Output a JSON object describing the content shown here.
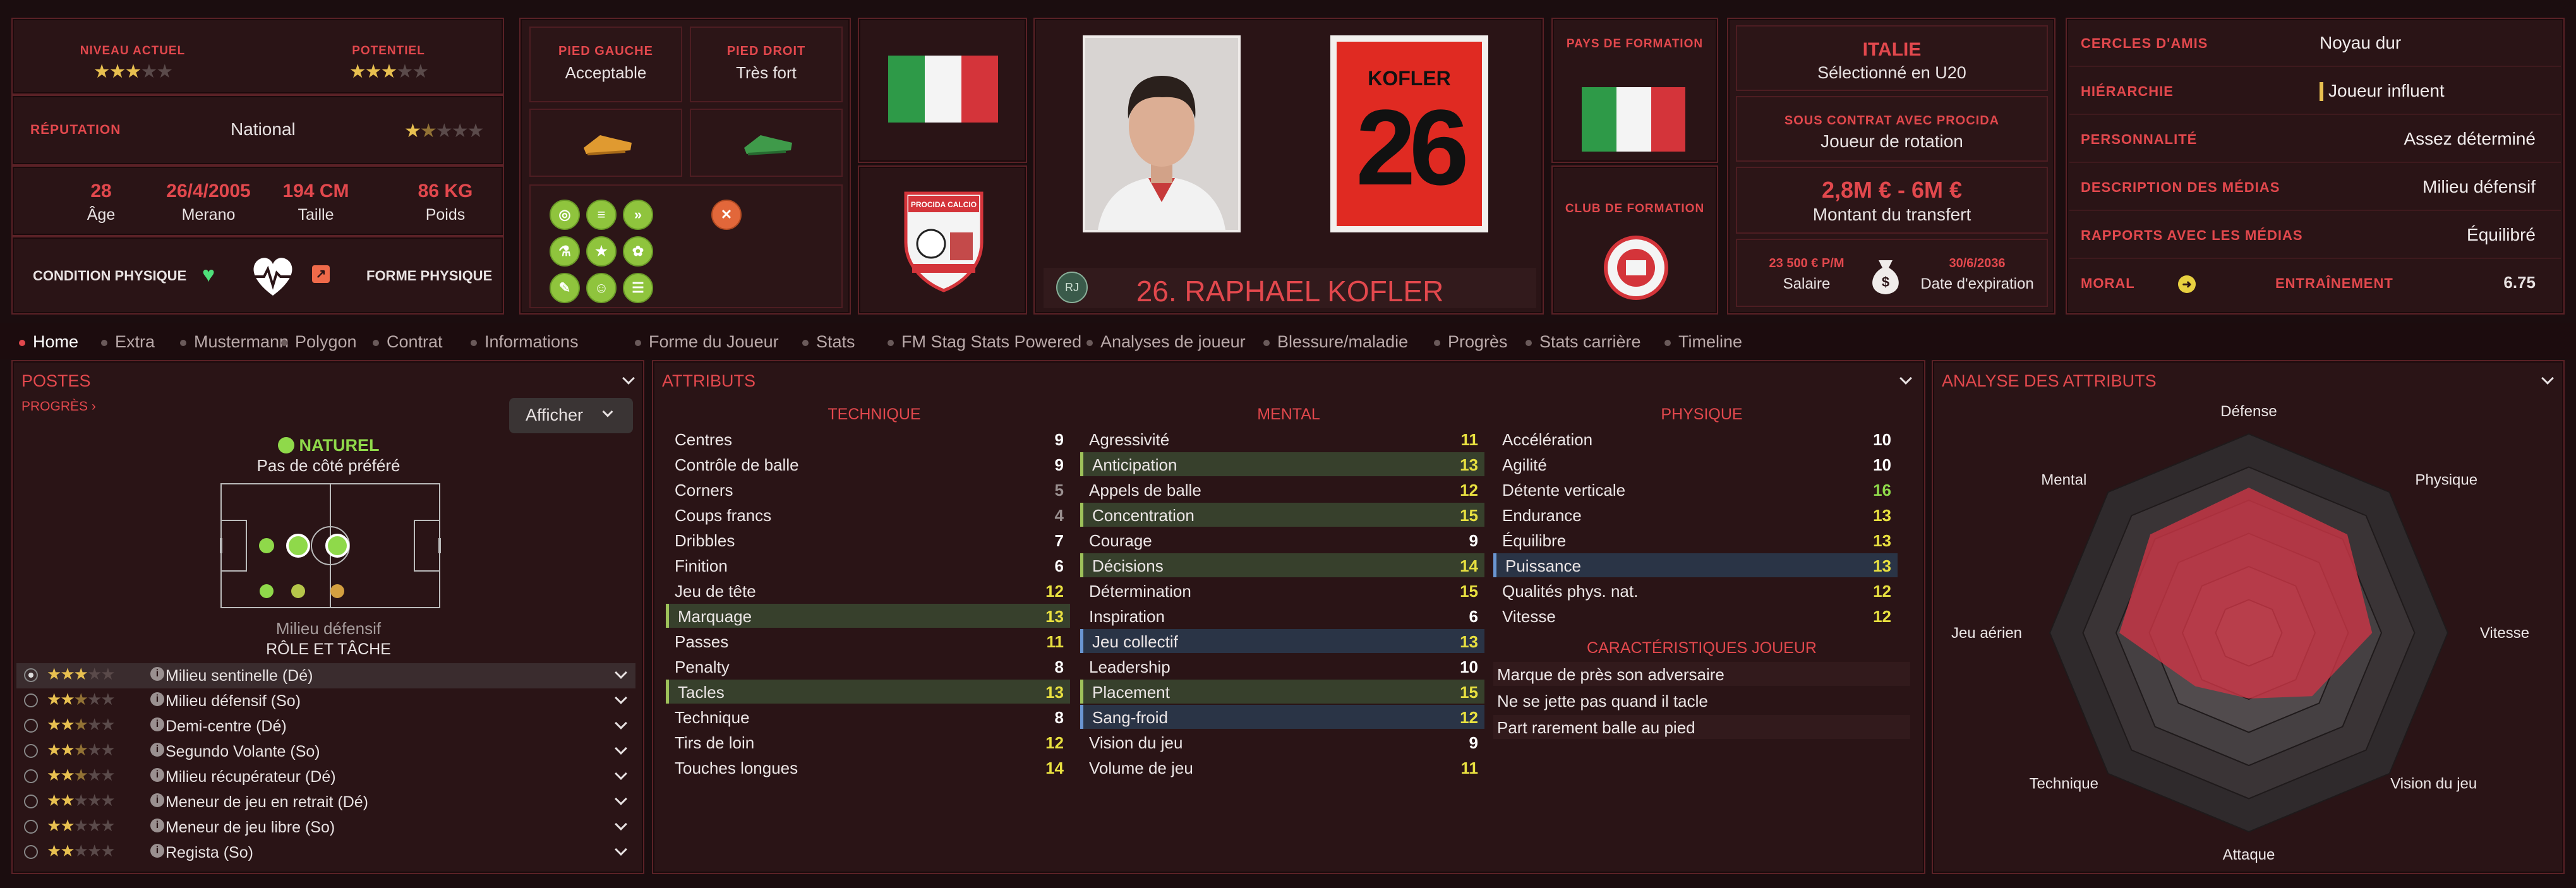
{
  "header": {
    "niveau_label": "NIVEAU ACTUEL",
    "potentiel_label": "POTENTIEL",
    "reputation_label": "RÉPUTATION",
    "reputation_value": "National",
    "age_value": "28",
    "age_label": "Âge",
    "birth_value": "26/4/2005",
    "birth_label": "Merano",
    "height_value": "194 CM",
    "height_label": "Taille",
    "weight_value": "86 KG",
    "weight_label": "Poids",
    "condition_label": "CONDITION PHYSIQUE",
    "forme_label": "FORME PHYSIQUE",
    "pied_gauche_label": "PIED GAUCHE",
    "pied_gauche_value": "Acceptable",
    "pied_droit_label": "PIED DROIT",
    "pied_droit_value": "Très fort",
    "club_crest_text": "PROCIDA CALCIO",
    "shirt_name": "KOFLER",
    "shirt_number": "26",
    "player_badge": "RJ",
    "player_title": "26. RAPHAEL KOFLER",
    "pays_formation_label": "PAYS DE FORMATION",
    "club_formation_label": "CLUB DE FORMATION",
    "nation_title": "ITALIE",
    "nation_sub": "Sélectionné en U20",
    "contract_label": "SOUS CONTRAT AVEC PROCIDA",
    "contract_value": "Joueur de rotation",
    "transfer_value": "2,8M € - 6M €",
    "transfer_label": "Montant du transfert",
    "salary_value": "23 500 € P/M",
    "salary_label": "Salaire",
    "expiry_value": "30/6/2036",
    "expiry_label": "Date d'expiration"
  },
  "right_panel": [
    {
      "label": "CERCLES D'AMIS",
      "value": "Noyau dur"
    },
    {
      "label": "HIÉRARCHIE",
      "value": "Joueur influent"
    },
    {
      "label": "PERSONNALITÉ",
      "value": "Assez déterminé"
    },
    {
      "label": "DESCRIPTION DES MÉDIAS",
      "value": "Milieu défensif"
    },
    {
      "label": "RAPPORTS AVEC LES MÉDIAS",
      "value": "Équilibré"
    }
  ],
  "moral": {
    "label": "MORAL",
    "training_label": "ENTRAÎNEMENT",
    "training_value": "6.75"
  },
  "tabs": [
    "Home",
    "Extra",
    "Mustermann",
    "Polygon",
    "Contrat",
    "Informations",
    "Forme du Joueur",
    "Stats",
    "FM Stag Stats Powered",
    "Analyses de joueur",
    "Blessure/maladie",
    "Progrès",
    "Stats carrière",
    "Timeline"
  ],
  "postes": {
    "title": "POSTES",
    "progres": "PROGRÈS",
    "afficher": "Afficher",
    "naturel": "NATUREL",
    "cote": "Pas de côté préféré",
    "position": "Milieu défensif",
    "role_title": "RÔLE ET TÂCHE",
    "roles": [
      {
        "name": "Milieu sentinelle (Dé)",
        "stars": 3,
        "half": false
      },
      {
        "name": "Milieu défensif (So)",
        "stars": 2,
        "half": true
      },
      {
        "name": "Demi-centre (Dé)",
        "stars": 2,
        "half": true
      },
      {
        "name": "Segundo Volante (So)",
        "stars": 2,
        "half": true
      },
      {
        "name": "Milieu récupérateur (Dé)",
        "stars": 2,
        "half": true
      },
      {
        "name": "Meneur de jeu en retrait (Dé)",
        "stars": 2,
        "half": false
      },
      {
        "name": "Meneur de jeu libre (So)",
        "stars": 2,
        "half": false
      },
      {
        "name": "Regista (So)",
        "stars": 2,
        "half": false
      }
    ]
  },
  "attributs": {
    "title": "ATTRIBUTS",
    "technique_title": "TECHNIQUE",
    "mental_title": "MENTAL",
    "physique_title": "PHYSIQUE",
    "technique": [
      {
        "name": "Centres",
        "value": "9",
        "hl": ""
      },
      {
        "name": "Contrôle de balle",
        "value": "9",
        "hl": ""
      },
      {
        "name": "Corners",
        "value": "5",
        "hl": ""
      },
      {
        "name": "Coups francs",
        "value": "4",
        "hl": ""
      },
      {
        "name": "Dribbles",
        "value": "7",
        "hl": ""
      },
      {
        "name": "Finition",
        "value": "6",
        "hl": ""
      },
      {
        "name": "Jeu de tête",
        "value": "12",
        "hl": ""
      },
      {
        "name": "Marquage",
        "value": "13",
        "hl": "green"
      },
      {
        "name": "Passes",
        "value": "11",
        "hl": ""
      },
      {
        "name": "Penalty",
        "value": "8",
        "hl": ""
      },
      {
        "name": "Tacles",
        "value": "13",
        "hl": "green"
      },
      {
        "name": "Technique",
        "value": "8",
        "hl": ""
      },
      {
        "name": "Tirs de loin",
        "value": "12",
        "hl": ""
      },
      {
        "name": "Touches longues",
        "value": "14",
        "hl": ""
      }
    ],
    "mental": [
      {
        "name": "Agressivité",
        "value": "11",
        "hl": ""
      },
      {
        "name": "Anticipation",
        "value": "13",
        "hl": "green"
      },
      {
        "name": "Appels de balle",
        "value": "12",
        "hl": ""
      },
      {
        "name": "Concentration",
        "value": "15",
        "hl": "green"
      },
      {
        "name": "Courage",
        "value": "9",
        "hl": ""
      },
      {
        "name": "Décisions",
        "value": "14",
        "hl": "green"
      },
      {
        "name": "Détermination",
        "value": "15",
        "hl": ""
      },
      {
        "name": "Inspiration",
        "value": "6",
        "hl": ""
      },
      {
        "name": "Jeu collectif",
        "value": "13",
        "hl": "blue"
      },
      {
        "name": "Leadership",
        "value": "10",
        "hl": ""
      },
      {
        "name": "Placement",
        "value": "15",
        "hl": "green"
      },
      {
        "name": "Sang-froid",
        "value": "12",
        "hl": "blue"
      },
      {
        "name": "Vision du jeu",
        "value": "9",
        "hl": ""
      },
      {
        "name": "Volume de jeu",
        "value": "11",
        "hl": ""
      }
    ],
    "physique": [
      {
        "name": "Accélération",
        "value": "10",
        "hl": ""
      },
      {
        "name": "Agilité",
        "value": "10",
        "hl": ""
      },
      {
        "name": "Détente verticale",
        "value": "16",
        "hl": ""
      },
      {
        "name": "Endurance",
        "value": "13",
        "hl": ""
      },
      {
        "name": "Équilibre",
        "value": "13",
        "hl": ""
      },
      {
        "name": "Puissance",
        "value": "13",
        "hl": "blue"
      },
      {
        "name": "Qualités phys. nat.",
        "value": "12",
        "hl": ""
      },
      {
        "name": "Vitesse",
        "value": "12",
        "hl": ""
      }
    ],
    "traits_title": "CARACTÉRISTIQUES JOUEUR",
    "traits": [
      "Marque de près son adversaire",
      "Ne se jette pas quand il tacle",
      "Part rarement balle au pied"
    ]
  },
  "analyse": {
    "title": "ANALYSE DES ATTRIBUTS",
    "axes": [
      "Défense",
      "Physique",
      "Vitesse",
      "Vision du jeu",
      "Attaque",
      "Technique",
      "Jeu aérien",
      "Mental"
    ],
    "values": [
      0.73,
      0.7,
      0.62,
      0.45,
      0.33,
      0.38,
      0.65,
      0.7
    ]
  },
  "colors": {
    "accent": "#e2484d",
    "panel": "#2a1416",
    "value_white": "#ffffff",
    "value_grey": "#9a9090",
    "value_yellow": "#e8e040",
    "value_green": "#8fd94a"
  }
}
